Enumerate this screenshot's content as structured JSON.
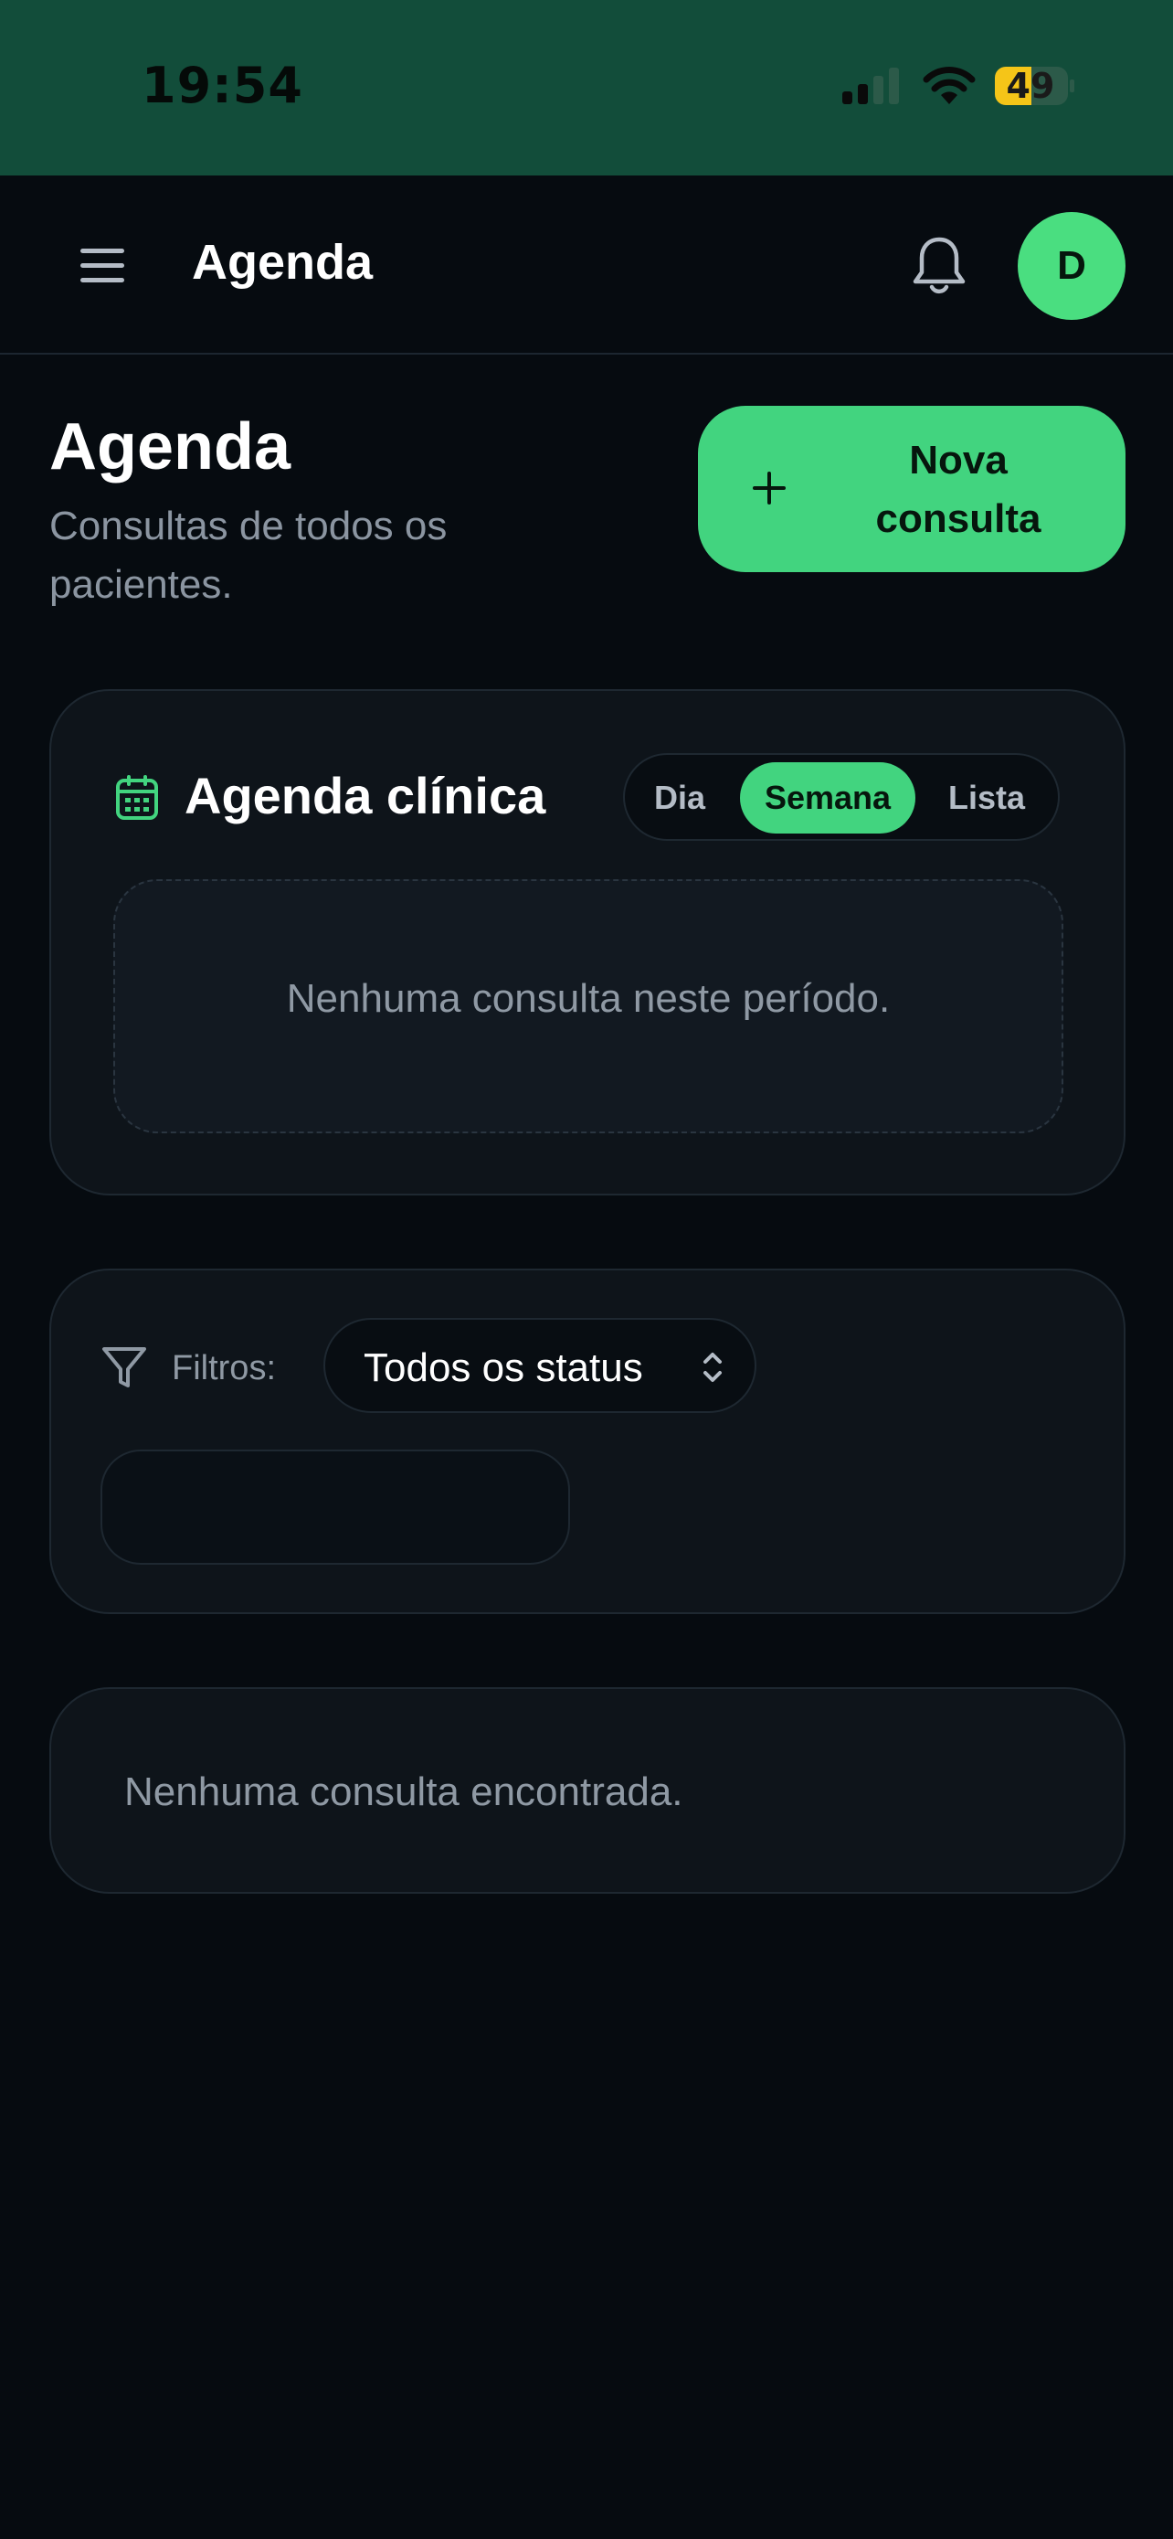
{
  "status_bar": {
    "time": "19:54",
    "battery": "49",
    "icons": [
      "signal-icon",
      "wifi-icon",
      "battery-icon"
    ]
  },
  "app_bar": {
    "title": "Agenda",
    "avatar_initial": "D",
    "icons": [
      "menu-icon",
      "bell-icon"
    ]
  },
  "header": {
    "title": "Agenda",
    "subtitle": "Consultas de todos os pacientes.",
    "new_button_label": "Nova consulta"
  },
  "agenda_card": {
    "title": "Agenda clínica",
    "views": [
      "Dia",
      "Semana",
      "Lista"
    ],
    "selected_view": "Semana",
    "empty_text": "Nenhuma consulta neste período."
  },
  "filters": {
    "label": "Filtros:",
    "status_value": "Todos os status",
    "date_value": ""
  },
  "results": {
    "empty_text": "Nenhuma consulta encontrada."
  },
  "colors": {
    "accent": "#42d47f",
    "status_bar_bg": "#124d3a",
    "background": "#060b10",
    "card": "#0e141a",
    "muted_text": "#8f99a4"
  }
}
